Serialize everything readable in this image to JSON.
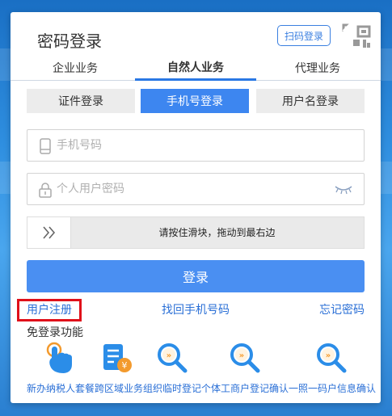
{
  "login": {
    "title": "密码登录",
    "scan_button": "扫码登录",
    "biz_tabs": [
      "企业业务",
      "自然人业务",
      "代理业务"
    ],
    "active_biz_tab": "自然人业务",
    "mode_tabs": [
      "证件登录",
      "手机号登录",
      "用户名登录"
    ],
    "active_mode_tab": "手机号登录",
    "phone_placeholder": "手机号码",
    "password_placeholder": "个人用户密码",
    "slider_text": "请按住滑块，拖动到最右边",
    "login_button": "登录"
  },
  "links": {
    "register": "用户注册",
    "retrieve_phone": "找回手机号码",
    "forgot_password": "忘记密码"
  },
  "quick": {
    "label": "免登录功能",
    "items_text": "新办纳税人套餐跨区域业务组织临时登记个体工商户登记确认一照一码户信息确认"
  },
  "colors": {
    "accent": "#3d86f0",
    "link": "#2a6fd6",
    "highlight": "#e0101a"
  }
}
